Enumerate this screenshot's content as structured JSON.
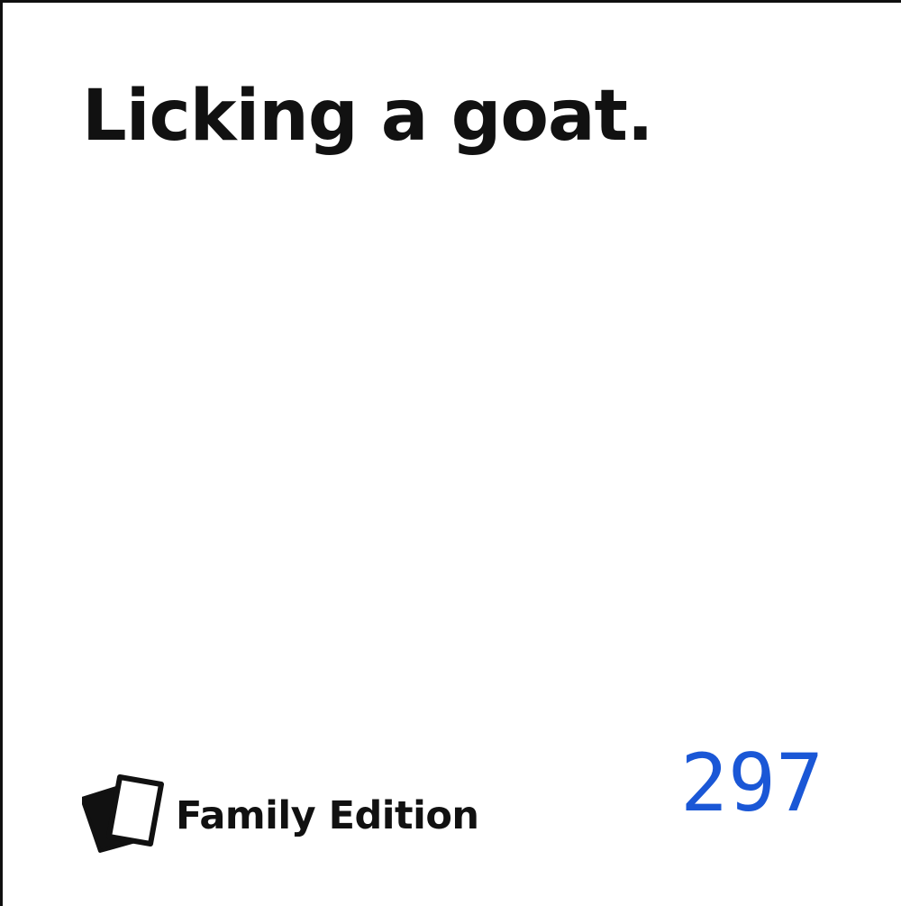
{
  "card": {
    "text": "Licking a goat.",
    "brand": {
      "name": "Family Edition",
      "logo_icon": "stacked-cards-icon"
    },
    "number": "297"
  },
  "colors": {
    "background": "#ffffff",
    "text": "#111111",
    "number": "#1a57d6",
    "border": "#0f0f0f"
  }
}
